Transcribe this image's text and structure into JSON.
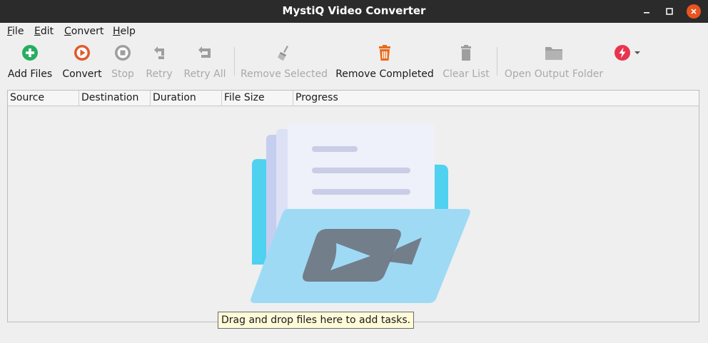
{
  "window": {
    "title": "MystiQ Video Converter"
  },
  "menu": [
    {
      "mnemonic": "F",
      "rest": "ile"
    },
    {
      "mnemonic": "E",
      "rest": "dit"
    },
    {
      "mnemonic": "C",
      "rest": "onvert"
    },
    {
      "mnemonic": "H",
      "rest": "elp"
    }
  ],
  "toolbar": {
    "add_files": "Add Files",
    "convert": "Convert",
    "stop": "Stop",
    "retry": "Retry",
    "retry_all": "Retry All",
    "remove_selected": "Remove Selected",
    "remove_completed": "Remove Completed",
    "clear_list": "Clear List",
    "open_output_folder": "Open Output Folder"
  },
  "table": {
    "columns": [
      "Source",
      "Destination",
      "Duration",
      "File Size",
      "Progress"
    ]
  },
  "tooltip": "Drag and drop files here to add tasks.",
  "colors": {
    "add": "#27ae60",
    "convert": "#e05a2b",
    "trash_active": "#e86a1a",
    "power": "#e8344e",
    "disabled_icon": "#9e9e9e"
  }
}
